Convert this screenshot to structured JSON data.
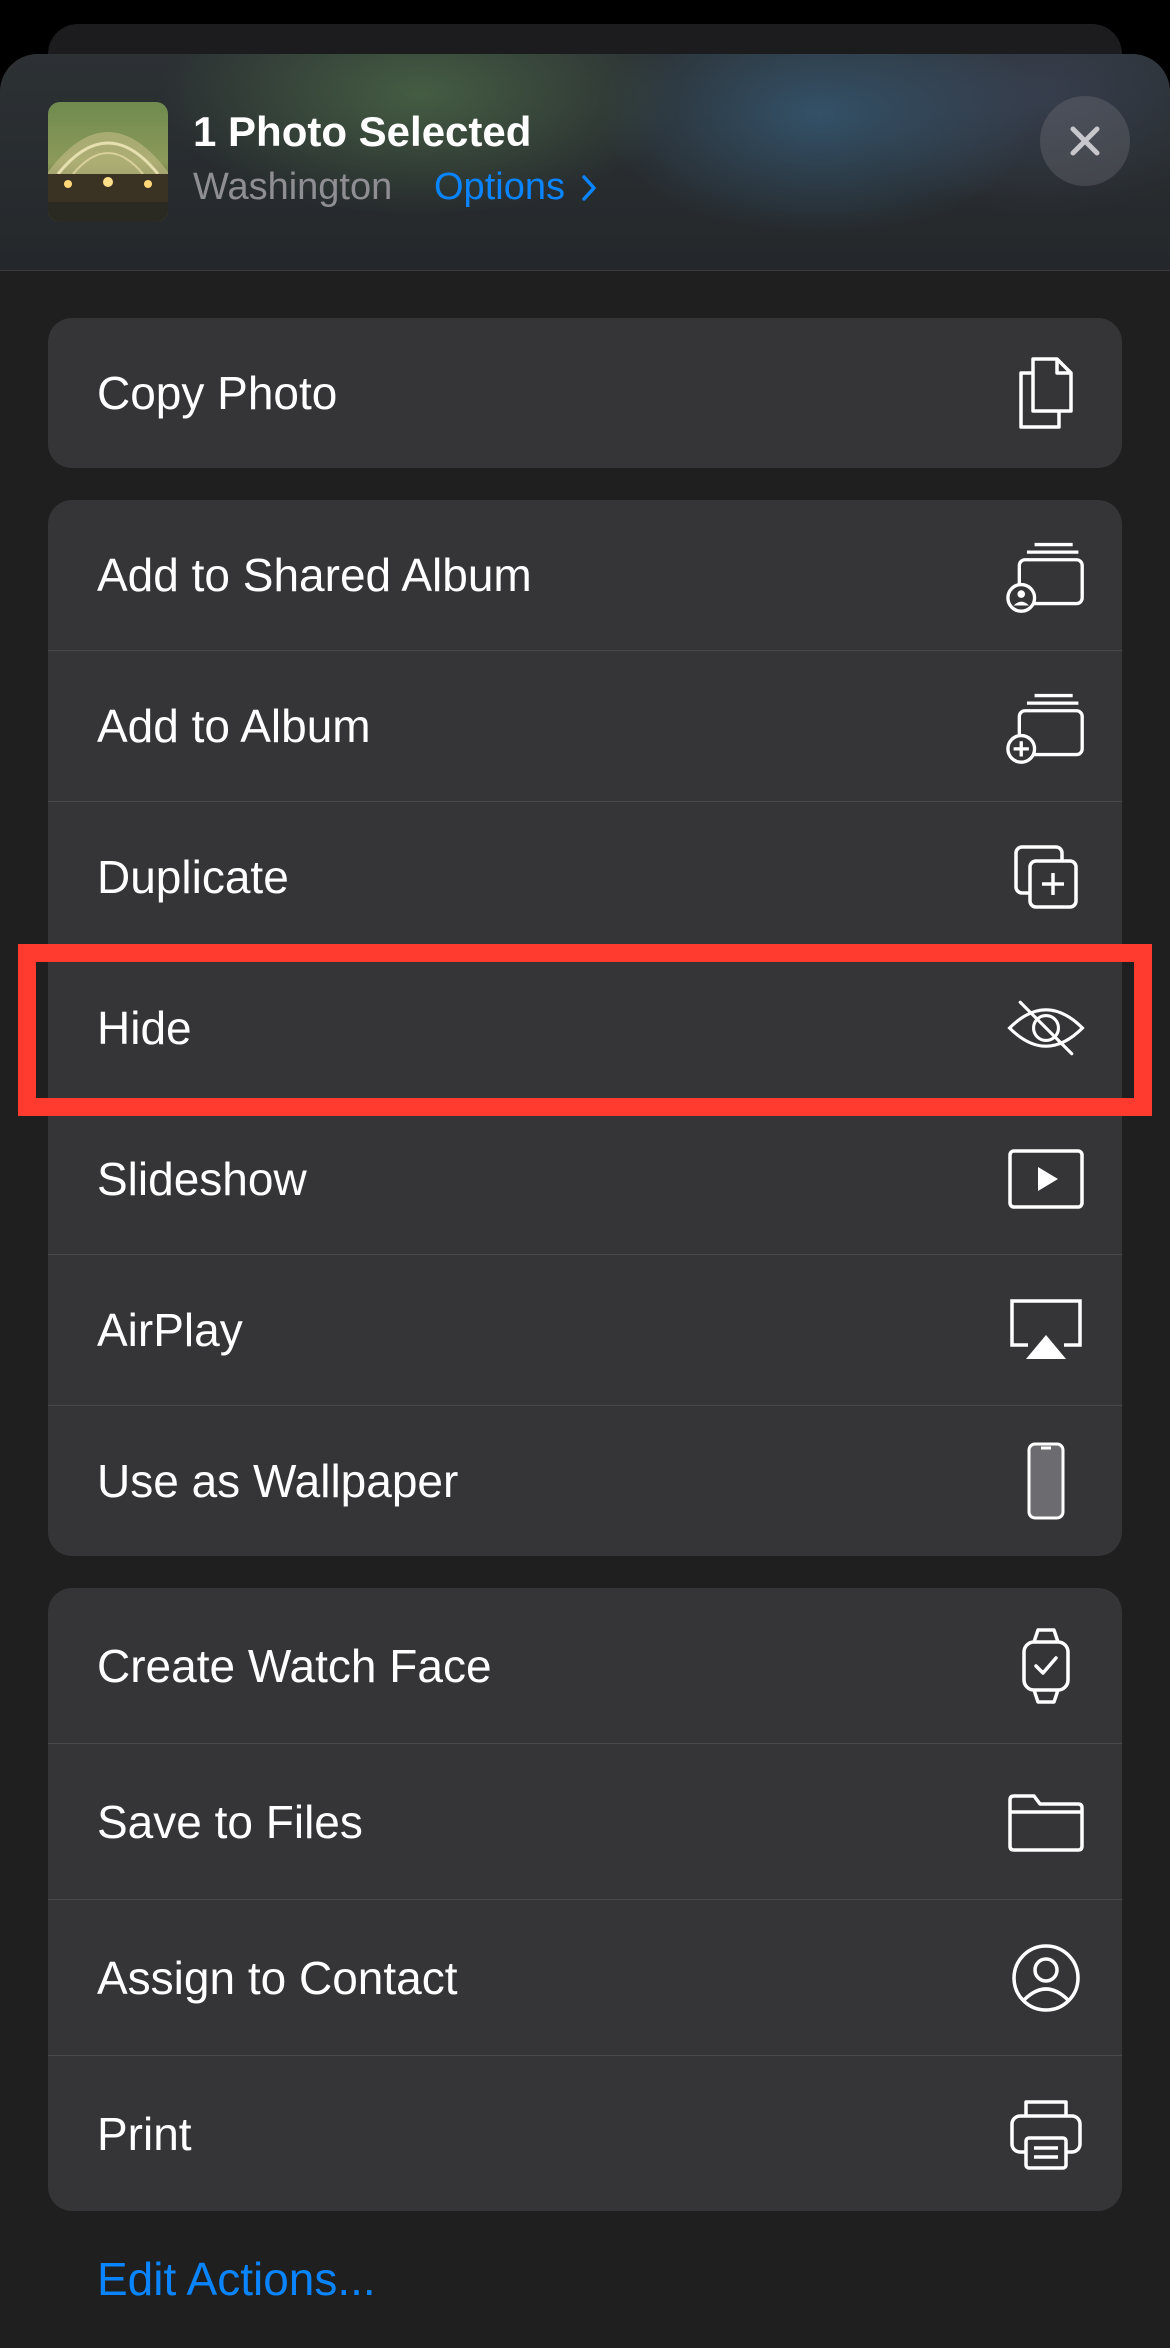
{
  "header": {
    "title": "1 Photo Selected",
    "subtitle": "Washington",
    "options_label": "Options",
    "thumbnail_icon": "photo-thumbnail",
    "close_icon": "close-icon"
  },
  "groups": [
    {
      "items": [
        {
          "label": "Copy Photo",
          "icon": "copy-icon"
        }
      ]
    },
    {
      "items": [
        {
          "label": "Add to Shared Album",
          "icon": "shared-album-icon"
        },
        {
          "label": "Add to Album",
          "icon": "add-album-icon"
        },
        {
          "label": "Duplicate",
          "icon": "duplicate-icon"
        },
        {
          "label": "Hide",
          "icon": "eye-slash-icon",
          "highlighted": true
        },
        {
          "label": "Slideshow",
          "icon": "play-icon"
        },
        {
          "label": "AirPlay",
          "icon": "airplay-icon"
        },
        {
          "label": "Use as Wallpaper",
          "icon": "phone-icon"
        }
      ]
    },
    {
      "items": [
        {
          "label": "Create Watch Face",
          "icon": "watch-icon"
        },
        {
          "label": "Save to Files",
          "icon": "folder-icon"
        },
        {
          "label": "Assign to Contact",
          "icon": "person-circle-icon"
        },
        {
          "label": "Print",
          "icon": "printer-icon"
        }
      ]
    }
  ],
  "footer": {
    "edit_actions_label": "Edit Actions..."
  },
  "colors": {
    "accent": "#0a84ff",
    "highlight_border": "#ff3b30",
    "row_background": "#353537",
    "sheet_background": "#1f1f1f"
  }
}
